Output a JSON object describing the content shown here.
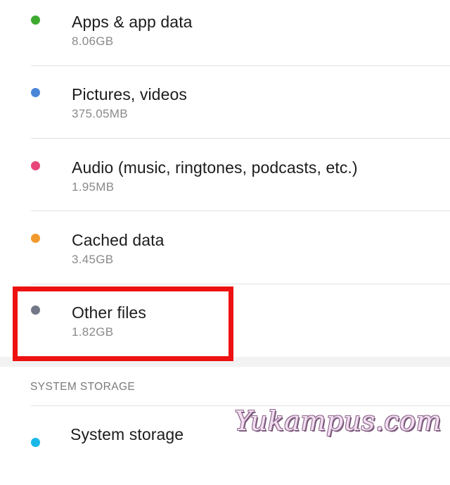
{
  "storage_items": [
    {
      "label": "Apps & app data",
      "size": "8.06GB",
      "color": "#3daa2f",
      "icon": "category-dot-icon"
    },
    {
      "label": "Pictures, videos",
      "size": "375.05MB",
      "color": "#4a86d8",
      "icon": "category-dot-icon"
    },
    {
      "label": "Audio (music, ringtones, podcasts, etc.)",
      "size": "1.95MB",
      "color": "#e8467a",
      "icon": "category-dot-icon"
    },
    {
      "label": "Cached data",
      "size": "3.45GB",
      "color": "#f29a2e",
      "icon": "category-dot-icon"
    },
    {
      "label": "Other files",
      "size": "1.82GB",
      "color": "#737888",
      "icon": "category-dot-icon"
    }
  ],
  "system_section": {
    "header": "SYSTEM STORAGE",
    "item": {
      "label": "System storage",
      "size": "",
      "color": "#19b8e8",
      "icon": "category-dot-icon"
    }
  },
  "highlight": {
    "target": "Other files",
    "color": "#ee1111"
  },
  "watermark": {
    "text": "Yukampus.com"
  }
}
